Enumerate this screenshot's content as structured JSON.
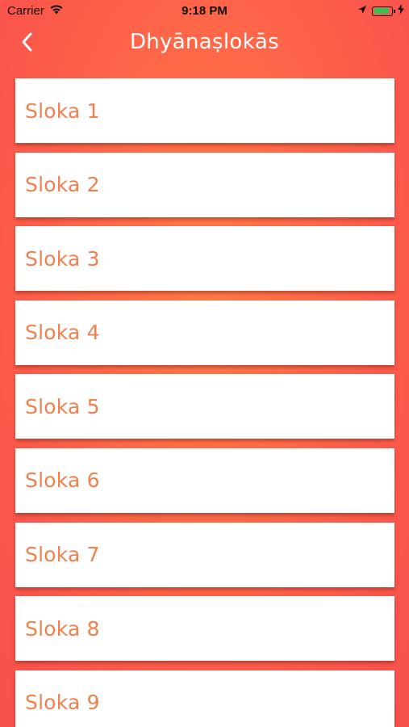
{
  "status_bar": {
    "carrier": "Carrier",
    "time": "9:18 PM",
    "battery_level": 0.9,
    "icons": [
      "wifi-icon",
      "location-arrow-icon",
      "battery-icon",
      "charging-bolt-icon"
    ]
  },
  "nav": {
    "back_icon": "chevron-left-icon",
    "title": "Dhyānaṣlokās"
  },
  "list": {
    "items": [
      {
        "label": "Sloka 1"
      },
      {
        "label": "Sloka 2"
      },
      {
        "label": "Sloka 3"
      },
      {
        "label": "Sloka 4"
      },
      {
        "label": "Sloka 5"
      },
      {
        "label": "Sloka 6"
      },
      {
        "label": "Sloka 7"
      },
      {
        "label": "Sloka 8"
      },
      {
        "label": "Sloka 9"
      }
    ]
  },
  "colors": {
    "background_gradient": [
      "#ff7a45",
      "#f8504d"
    ],
    "item_background": "#ffffff",
    "item_text": "#f0814f",
    "title_text": "#ffffff",
    "battery_fill": "#3fc04a"
  }
}
